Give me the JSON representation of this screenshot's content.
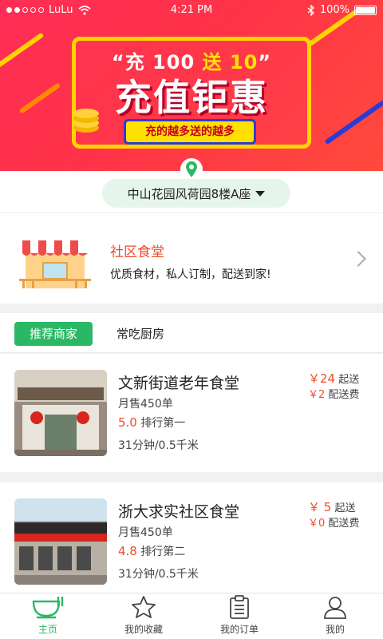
{
  "status_bar": {
    "carrier": "LuLu",
    "time": "4:21 PM",
    "battery": "100%"
  },
  "banner": {
    "headline_prefix": "充 100 ",
    "headline_gift": "送 10",
    "title": "充值钜惠",
    "subtitle": "充的越多送的越多",
    "colors": {
      "background": "#ff3348",
      "accent": "#ffe100"
    }
  },
  "location": {
    "address": "中山花园风荷园8楼A座"
  },
  "community": {
    "title": "社区食堂",
    "description": "优质食材，私人订制，配送到家!"
  },
  "tabs": [
    {
      "label": "推荐商家",
      "active": true
    },
    {
      "label": "常吃厨房",
      "active": false
    }
  ],
  "stores": [
    {
      "name": "文新街道老年食堂",
      "sales": "月售450单",
      "score": "5.0",
      "rank": "排行第一",
      "delivery": "31分钟/0.5千米",
      "min_price": "￥24",
      "min_label": "起送",
      "fee": "￥2",
      "fee_label": "配送费"
    },
    {
      "name": "浙大求实社区食堂",
      "sales": "月售450单",
      "score": "4.8",
      "rank": "排行第二",
      "delivery": "31分钟/0.5千米",
      "min_price": "￥ 5",
      "min_label": "起送",
      "fee": "￥0",
      "fee_label": "配送费"
    }
  ],
  "bottom_nav": [
    {
      "label": "主页",
      "icon": "bowl-icon",
      "active": true
    },
    {
      "label": "我的收藏",
      "icon": "star-icon",
      "active": false
    },
    {
      "label": "我的订单",
      "icon": "clipboard-icon",
      "active": false
    },
    {
      "label": "我的",
      "icon": "user-icon",
      "active": false
    }
  ],
  "colors": {
    "brand_green": "#2ab865",
    "price_red": "#f24a2a"
  }
}
